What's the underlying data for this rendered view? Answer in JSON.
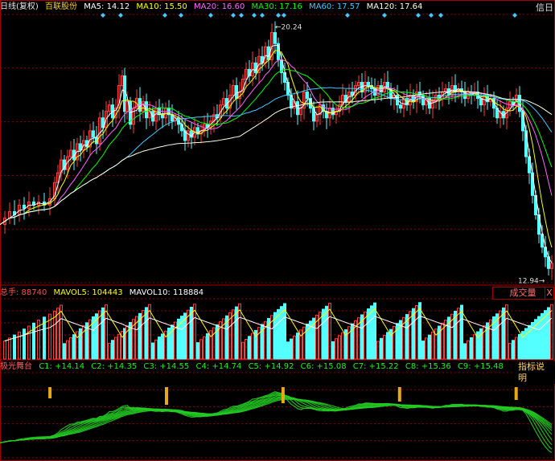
{
  "header": {
    "period": "日线(复权)",
    "stock": "百联股份",
    "ma": [
      {
        "label": "MA5: 14.12",
        "color": "#ffffff"
      },
      {
        "label": "MA10: 15.50",
        "color": "#ffff00"
      },
      {
        "label": "MA20: 16.60",
        "color": "#ff66ff"
      },
      {
        "label": "MA30: 17.16",
        "color": "#00ff00"
      },
      {
        "label": "MA60: 17.57",
        "color": "#44c8ff"
      },
      {
        "label": "MA120: 17.64",
        "color": "#ffffe0"
      }
    ],
    "logo_text": "信日"
  },
  "volume_header": {
    "total_label": "总手: 88740",
    "mavol5": "MAVOL5: 104443",
    "mavol10": "MAVOL10: 118884",
    "button_label": "成交量",
    "button_x": "X"
  },
  "indicator_header": {
    "name": "极光舞台",
    "values": [
      "C1: +14.14",
      "C2: +14.35",
      "C3: +14.55",
      "C4: +14.74",
      "C5: +14.92",
      "C6: +15.08",
      "C7: +15.22",
      "C8: +15.36",
      "C9: +15.48"
    ],
    "help_label": "指标说明"
  },
  "colors": {
    "up": "#ff3c3c",
    "down": "#54ffff",
    "grid": "#8b0000",
    "indicator": "#22cc22",
    "marker": "#e6a817"
  },
  "chart_data": {
    "type": "candlestick",
    "price_max_label": "20.24",
    "price_min_label": "12.94",
    "ylim": [
      12.5,
      20.8
    ],
    "price_points": [
      [
        0,
        14.3
      ],
      [
        6,
        14.5
      ],
      [
        12,
        14.7
      ],
      [
        18,
        14.6
      ],
      [
        24,
        14.9
      ],
      [
        30,
        14.8
      ],
      [
        36,
        15.0
      ],
      [
        42,
        14.9
      ],
      [
        48,
        15.0
      ],
      [
        55,
        14.9
      ],
      [
        62,
        15.1
      ],
      [
        68,
        15.6
      ],
      [
        72,
        15.9
      ],
      [
        76,
        16.3
      ],
      [
        80,
        16.0
      ],
      [
        84,
        16.4
      ],
      [
        88,
        16.6
      ],
      [
        92,
        16.3
      ],
      [
        96,
        16.8
      ],
      [
        100,
        16.6
      ],
      [
        104,
        16.9
      ],
      [
        108,
        16.7
      ],
      [
        112,
        17.2
      ],
      [
        116,
        17.0
      ],
      [
        120,
        16.8
      ],
      [
        124,
        17.6
      ],
      [
        128,
        17.3
      ],
      [
        132,
        17.8
      ],
      [
        136,
        18.0
      ],
      [
        140,
        17.6
      ],
      [
        144,
        17.9
      ],
      [
        148,
        18.6
      ],
      [
        152,
        18.9
      ],
      [
        155,
        17.8
      ],
      [
        158,
        18.1
      ],
      [
        162,
        17.4
      ],
      [
        166,
        17.9
      ],
      [
        170,
        18.2
      ],
      [
        174,
        17.8
      ],
      [
        178,
        18.1
      ],
      [
        182,
        17.6
      ],
      [
        186,
        17.8
      ],
      [
        190,
        17.5
      ],
      [
        194,
        17.9
      ],
      [
        198,
        17.7
      ],
      [
        202,
        17.6
      ],
      [
        206,
        17.9
      ],
      [
        210,
        17.7
      ],
      [
        214,
        17.5
      ],
      [
        218,
        17.6
      ],
      [
        222,
        17.4
      ],
      [
        226,
        17.2
      ],
      [
        230,
        16.9
      ],
      [
        234,
        17.2
      ],
      [
        238,
        17.0
      ],
      [
        242,
        17.3
      ],
      [
        246,
        17.1
      ],
      [
        250,
        17.2
      ],
      [
        254,
        17.4
      ],
      [
        258,
        17.3
      ],
      [
        262,
        17.5
      ],
      [
        266,
        17.7
      ],
      [
        270,
        17.6
      ],
      [
        274,
        18.0
      ],
      [
        278,
        18.2
      ],
      [
        282,
        17.9
      ],
      [
        286,
        18.3
      ],
      [
        290,
        18.6
      ],
      [
        294,
        18.2
      ],
      [
        298,
        18.4
      ],
      [
        302,
        18.8
      ],
      [
        306,
        19.1
      ],
      [
        310,
        18.9
      ],
      [
        314,
        19.3
      ],
      [
        318,
        19.0
      ],
      [
        322,
        19.5
      ],
      [
        326,
        19.3
      ],
      [
        330,
        19.8
      ],
      [
        334,
        19.4
      ],
      [
        338,
        20.24
      ],
      [
        342,
        19.9
      ],
      [
        346,
        19.4
      ],
      [
        350,
        19.0
      ],
      [
        354,
        18.7
      ],
      [
        358,
        18.3
      ],
      [
        362,
        17.9
      ],
      [
        366,
        18.1
      ],
      [
        370,
        17.7
      ],
      [
        374,
        17.9
      ],
      [
        378,
        18.4
      ],
      [
        382,
        18.2
      ],
      [
        386,
        17.9
      ],
      [
        390,
        17.5
      ],
      [
        394,
        17.7
      ],
      [
        398,
        18.0
      ],
      [
        402,
        17.8
      ],
      [
        406,
        17.6
      ],
      [
        410,
        17.9
      ],
      [
        414,
        17.7
      ],
      [
        418,
        17.8
      ],
      [
        422,
        18.0
      ],
      [
        426,
        18.3
      ],
      [
        430,
        18.1
      ],
      [
        434,
        18.4
      ],
      [
        438,
        18.3
      ],
      [
        442,
        18.6
      ],
      [
        446,
        18.7
      ],
      [
        450,
        18.4
      ],
      [
        454,
        18.7
      ],
      [
        458,
        18.6
      ],
      [
        462,
        18.5
      ],
      [
        466,
        18.3
      ],
      [
        470,
        18.6
      ],
      [
        474,
        18.4
      ],
      [
        478,
        18.7
      ],
      [
        482,
        18.5
      ],
      [
        486,
        18.2
      ],
      [
        490,
        18.3
      ],
      [
        494,
        18.0
      ],
      [
        498,
        17.9
      ],
      [
        502,
        18.2
      ],
      [
        506,
        18.0
      ],
      [
        510,
        18.3
      ],
      [
        514,
        18.1
      ],
      [
        518,
        18.4
      ],
      [
        522,
        18.3
      ],
      [
        526,
        18.0
      ],
      [
        530,
        18.2
      ],
      [
        534,
        17.9
      ],
      [
        538,
        18.1
      ],
      [
        542,
        18.3
      ],
      [
        546,
        18.2
      ],
      [
        550,
        18.4
      ],
      [
        554,
        18.5
      ],
      [
        558,
        18.3
      ],
      [
        562,
        18.6
      ],
      [
        566,
        18.4
      ],
      [
        570,
        18.5
      ],
      [
        574,
        18.4
      ],
      [
        578,
        18.2
      ],
      [
        582,
        18.4
      ],
      [
        586,
        18.3
      ],
      [
        590,
        18.4
      ],
      [
        594,
        18.2
      ],
      [
        598,
        18.0
      ],
      [
        602,
        18.3
      ],
      [
        606,
        18.1
      ],
      [
        610,
        18.2
      ],
      [
        614,
        17.9
      ],
      [
        618,
        17.6
      ],
      [
        622,
        17.8
      ],
      [
        626,
        17.6
      ],
      [
        630,
        17.9
      ],
      [
        634,
        18.1
      ],
      [
        638,
        18.0
      ],
      [
        642,
        18.3
      ],
      [
        646,
        17.8
      ],
      [
        650,
        17.2
      ],
      [
        654,
        16.4
      ],
      [
        658,
        15.9
      ],
      [
        662,
        15.2
      ],
      [
        666,
        14.6
      ],
      [
        670,
        14.0
      ],
      [
        674,
        13.6
      ],
      [
        678,
        13.3
      ],
      [
        682,
        12.94
      ],
      [
        686,
        13.1
      ]
    ],
    "volume_max": 160000,
    "indicator_markers": [
      {
        "x_frac": 0.09,
        "height": 14
      },
      {
        "x_frac": 0.3,
        "height": 22
      },
      {
        "x_frac": 0.51,
        "height": 20
      },
      {
        "x_frac": 0.72,
        "height": 18
      },
      {
        "x_frac": 0.93,
        "height": 16
      }
    ]
  }
}
